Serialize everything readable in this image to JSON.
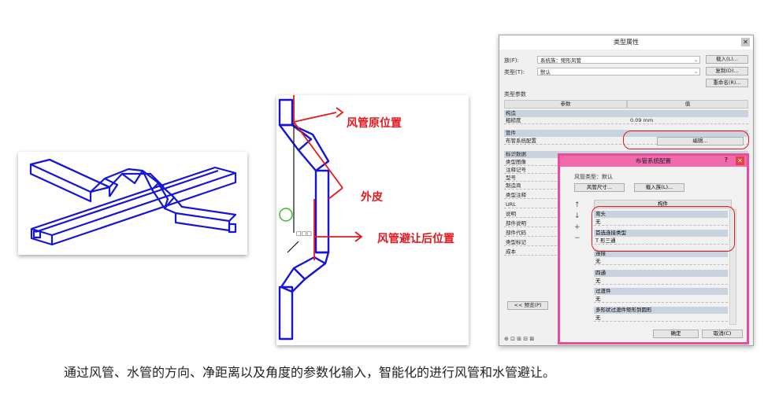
{
  "annotations": {
    "original_position": "风管原位置",
    "outer_skin": "外皮",
    "avoided_position": "风管避让后位置"
  },
  "caption": "通过风管、水管的方向、净距离以及角度的参数化输入，智能化的进行风管和水管避让。",
  "type_properties": {
    "title": "类型属性",
    "family_label": "族(F):",
    "family_value": "系统族：矩形风管",
    "type_label": "类型(T):",
    "type_value": "默认",
    "load_button": "载入(L)...",
    "duplicate_button": "复制(D)...",
    "rename_button": "重命名(R)...",
    "type_params_label": "类型参数",
    "col_param": "参数",
    "col_value": "值",
    "group_construction": "构造",
    "row_roughness": "粗糙度",
    "row_roughness_value": "0.09 mm",
    "group_fittings": "管件",
    "row_routing": "布管系统配置",
    "row_routing_value": "编辑...",
    "group_identity": "标识数据",
    "identity_rows": [
      "类型图像",
      "注释记号",
      "型号",
      "制造商",
      "类型注释",
      "URL",
      "说明",
      "部件说明",
      "部件代码",
      "类型标记",
      "成本"
    ],
    "preview_button": "<< 预览(P)"
  },
  "routing_config": {
    "title": "布管系统配置",
    "segments_label": "风管类型：默认",
    "size_button": "风管尺寸...",
    "load_family_button": "载入族(L)...",
    "col_header": "构件",
    "groups": [
      {
        "name": "弯头",
        "value": "无"
      },
      {
        "name": "首选连接类型",
        "value": "T 形三通"
      },
      {
        "name": "连接",
        "value": "无"
      },
      {
        "name": "四通",
        "value": "无"
      },
      {
        "name": "过渡件",
        "value": "无"
      },
      {
        "name": "多形状过渡件矩形到圆形",
        "value": "无"
      }
    ],
    "ok_button": "确定",
    "cancel_button": "取消(C)"
  }
}
